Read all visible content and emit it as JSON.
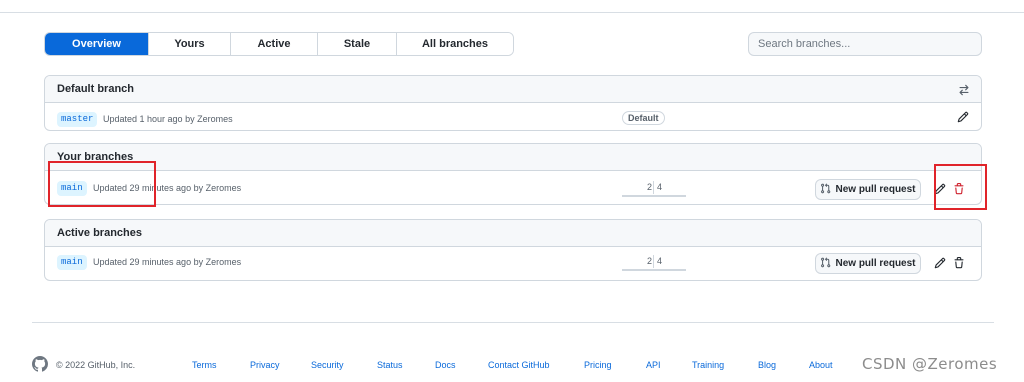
{
  "tabs": [
    {
      "label": "Overview",
      "selected": true
    },
    {
      "label": "Yours"
    },
    {
      "label": "Active"
    },
    {
      "label": "Stale"
    },
    {
      "label": "All branches"
    }
  ],
  "search": {
    "placeholder": "Search branches..."
  },
  "default_branch": {
    "title": "Default branch",
    "header_icon": "arrow-switch-icon",
    "branch": {
      "name": "master",
      "updated": "Updated 1 hour ago by Zeromes",
      "badge": "Default"
    }
  },
  "your_branches": {
    "title": "Your branches",
    "branch": {
      "name": "main",
      "updated": "Updated 29 minutes ago by Zeromes",
      "behind": "2",
      "ahead": "4",
      "pr_label": "New pull request"
    }
  },
  "active_branches": {
    "title": "Active branches",
    "branch": {
      "name": "main",
      "updated": "Updated 29 minutes ago by Zeromes",
      "behind": "2",
      "ahead": "4",
      "pr_label": "New pull request"
    }
  },
  "footer": {
    "copyright": "© 2022 GitHub, Inc.",
    "links": [
      "Terms",
      "Privacy",
      "Security",
      "Status",
      "Docs",
      "Contact GitHub",
      "Pricing",
      "API",
      "Training",
      "Blog",
      "About"
    ]
  },
  "watermark": "CSDN @Zeromes",
  "colors": {
    "accent": "#0969da",
    "danger": "#cf222e",
    "annotation": "#e0242a"
  }
}
